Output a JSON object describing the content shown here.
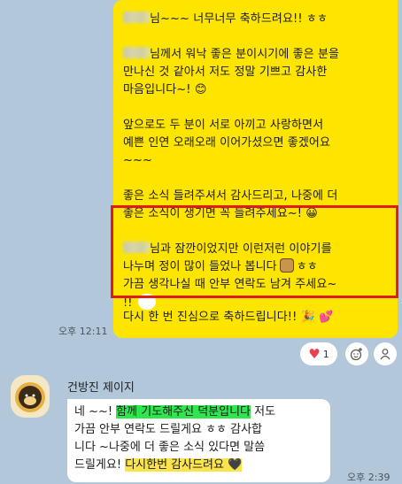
{
  "my_message": {
    "line1": "님~~~ 너무너무 축하드려요!! ㅎㅎ",
    "para2_a": "님께서 워낙 좋은 분이시기에 좋은 분을",
    "para2_b": "만나신 것 같아서 저도 정말 기쁘고 감사한",
    "para2_c": "마음입니다~! 😊",
    "para3_a": "앞으로도 두 분이 서로 아끼고 사랑하면서",
    "para3_b": "예쁜 인연 오래오래 이어가셨으면 좋겠어요",
    "para3_c": "~~~",
    "para4_a": "좋은 소식 들려주셔서 감사드리고, 나중에 더",
    "para4_b": "좋은 소식이 생기면 꼭 들려주세요~! 😀",
    "para5_a": "님과 잠깐이었지만 이런저런 이야기를",
    "para5_b": "나누며 정이 많이 들었나 봅니다",
    "para5_b2": "ㅎㅎ",
    "para5_c": "가끔 생각나실 때 안부 연락도 남겨 주세요~",
    "para5_d": "!!",
    "last_line": "다시 한 번 진심으로 축하드립니다!! 🎉 💕",
    "time": "오후 12:11"
  },
  "reactions": {
    "heart_count": "1"
  },
  "other_message": {
    "sender": "건방진 제이지",
    "l1_a": "네 ~~! ",
    "l1_g": "함께 기도해주신 덕분입니다",
    "l1_b": " 저도",
    "l2": "가끔 안부 연락도 드릴게요 ㅎㅎ 감사합",
    "l3": "니다 ~나중에 더 좋은 소식 있다면 말씀",
    "l4_a": "드릴게요! ",
    "l4_y": "다시한번 감사드려요 🖤",
    "time": "오후 2:39"
  },
  "icon_colors": {
    "heart": "#e8434c",
    "bubble_me": "#fee500",
    "bg": "#b2c7d9"
  }
}
